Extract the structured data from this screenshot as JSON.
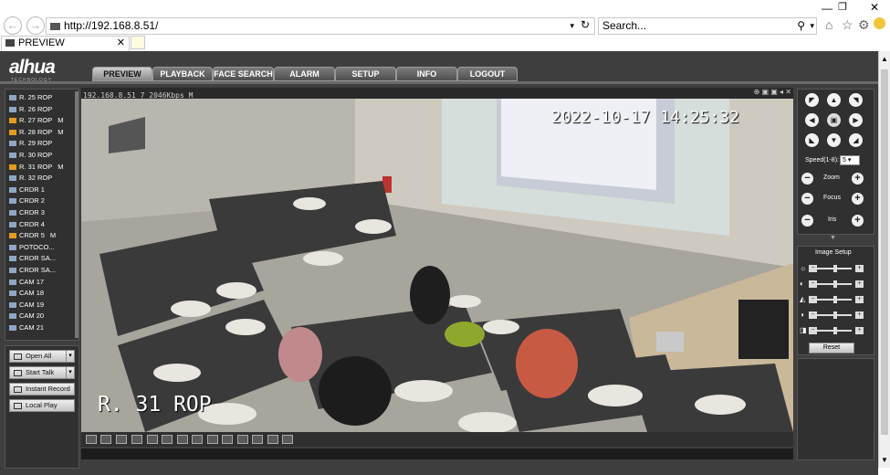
{
  "browser": {
    "url": "http://192.168.8.51/",
    "search_placeholder": "Search...",
    "tab_title": "PREVIEW"
  },
  "app": {
    "logo": "alhua",
    "logo_sub": "TECHNOLOGY"
  },
  "nav": [
    "PREVIEW",
    "PLAYBACK",
    "FACE SEARCH",
    "ALARM",
    "SETUP",
    "INFO",
    "LOGOUT"
  ],
  "channels": [
    {
      "label": "R. 25 ROP",
      "m": "",
      "on": false
    },
    {
      "label": "R. 26 ROP",
      "m": "",
      "on": false
    },
    {
      "label": "R. 27 ROP",
      "m": "M",
      "on": true
    },
    {
      "label": "R. 28 ROP",
      "m": "M",
      "on": true
    },
    {
      "label": "R. 29 ROP",
      "m": "",
      "on": false
    },
    {
      "label": "R. 30 ROP",
      "m": "",
      "on": false
    },
    {
      "label": "R. 31 ROP",
      "m": "M",
      "on": true
    },
    {
      "label": "R. 32 ROP",
      "m": "",
      "on": false
    },
    {
      "label": "CRDR 1",
      "m": "",
      "on": false
    },
    {
      "label": "CRDR 2",
      "m": "",
      "on": false
    },
    {
      "label": "CRDR 3",
      "m": "",
      "on": false
    },
    {
      "label": "CRDR 4",
      "m": "",
      "on": false
    },
    {
      "label": "CRDR 5",
      "m": "M",
      "on": true
    },
    {
      "label": "POTOCO...",
      "m": "",
      "on": false
    },
    {
      "label": "CRDR SA...",
      "m": "",
      "on": false
    },
    {
      "label": "CRDR SA...",
      "m": "",
      "on": false
    },
    {
      "label": "CAM 17",
      "m": "",
      "on": false
    },
    {
      "label": "CAM 18",
      "m": "",
      "on": false
    },
    {
      "label": "CAM 19",
      "m": "",
      "on": false
    },
    {
      "label": "CAM 20",
      "m": "",
      "on": false
    },
    {
      "label": "CAM 21",
      "m": "",
      "on": false
    }
  ],
  "controls": {
    "open_all": "Open All",
    "start_talk": "Start Talk",
    "instant_record": "Instant Record",
    "local_play": "Local Play"
  },
  "video": {
    "header": "192.168.8.51_7_2046Kbps_M",
    "timestamp": "2022-10-17 14:25:32",
    "camera_name": "R. 31 ROP"
  },
  "ptz": {
    "speed_label": "Speed(1-8):",
    "speed_value": "5",
    "zoom": "Zoom",
    "focus": "Focus",
    "iris": "Iris"
  },
  "image_setup": {
    "title": "Image Setup",
    "reset": "Reset"
  }
}
